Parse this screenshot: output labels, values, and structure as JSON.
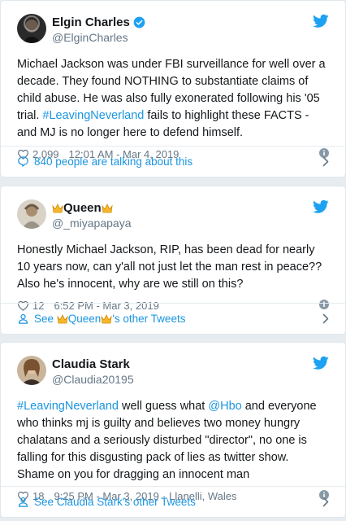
{
  "tweets": [
    {
      "name": "Elgin Charles",
      "handle": "@ElginCharles",
      "verified": true,
      "text_plain_1": "Michael Jackson was under FBI surveillance for well over a decade. They found NOTHING to substantiate claims of child abuse. He was also fully exonerated following his '05 trial. ",
      "hashtag": "#LeavingNeverland",
      "text_plain_2": " fails to highlight these FACTS - and MJ is no longer here to defend himself.",
      "likes": "2,099",
      "time": "12:01 AM - Mar 4, 2019",
      "footer": "840 people are talking about this"
    },
    {
      "name_emoji_left": "👑",
      "name": "Queen",
      "name_emoji_right": "👑",
      "handle": "@_miyapapaya",
      "text": "Honestly Michael Jackson, RIP, has been dead for nearly 10 years now, can y'all not just let the man rest in peace?? Also he's innocent, why are we still on this?",
      "likes": "12",
      "time": "6:52 PM - Mar 3, 2019",
      "footer_pre": "See ",
      "footer_name": "Queen",
      "footer_post": "'s other Tweets"
    },
    {
      "name": "Claudia Stark",
      "handle": "@Claudia20195",
      "hashtag": "#LeavingNeverland",
      "text_plain_1": " well guess what ",
      "mention": "@Hbo",
      "text_plain_2": " and everyone who thinks mj is guilty and believes two money hungry chalatans and a seriously disturbed \"director\", no one is falling for this disgusting pack of lies as twitter show. Shame on you for dragging an innocent man",
      "likes": "18",
      "time": "9:25 PM - Mar 3, 2019",
      "location": "Llanelli, Wales",
      "footer": "See Claudia Stark's other Tweets"
    }
  ],
  "colors": {
    "link": "#1b95e0",
    "muted": "#657786",
    "twitter_blue": "#1da1f2",
    "border": "#e1e8ed"
  }
}
